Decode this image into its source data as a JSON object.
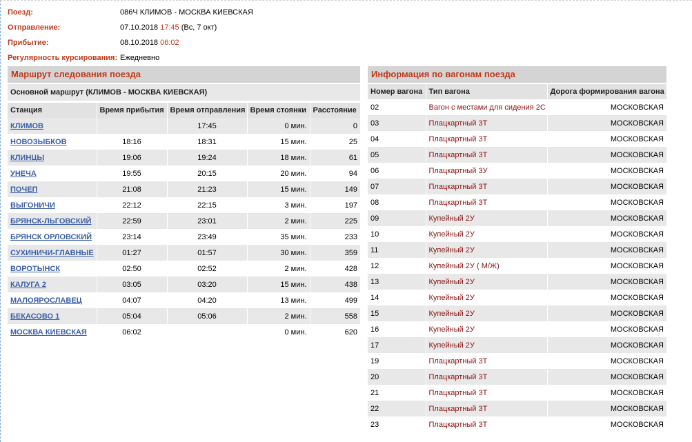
{
  "train_info": {
    "train_label": "Поезд:",
    "train_value": "086Ч КЛИМОВ - МОСКВА КИЕВСКАЯ",
    "departure_label": "Отправление:",
    "departure_date": "07.10.2018",
    "departure_time": "17:45",
    "departure_day": "(Вс, 7 окт)",
    "arrival_label": "Прибытие:",
    "arrival_date": "08.10.2018",
    "arrival_time": "06:02",
    "regularity_label": "Регулярность курсирования:",
    "regularity_value": "Ежедневно"
  },
  "route": {
    "title": "Маршрут следования поезда",
    "subtitle": "Основной маршрут (КЛИМОВ - МОСКВА КИЕВСКАЯ)",
    "headers": [
      "Станция",
      "Время прибытия",
      "Время отправления",
      "Время стоянки",
      "Расстояние"
    ],
    "rows": [
      {
        "station": "КЛИМОВ",
        "arrival": "",
        "departure": "17:45",
        "stop": "0 мин.",
        "distance": "0"
      },
      {
        "station": "НОВОЗЫБКОВ",
        "arrival": "18:16",
        "departure": "18:31",
        "stop": "15 мин.",
        "distance": "25"
      },
      {
        "station": "КЛИНЦЫ",
        "arrival": "19:06",
        "departure": "19:24",
        "stop": "18 мин.",
        "distance": "61"
      },
      {
        "station": "УНЕЧА",
        "arrival": "19:55",
        "departure": "20:15",
        "stop": "20 мин.",
        "distance": "94"
      },
      {
        "station": "ПОЧЕП",
        "arrival": "21:08",
        "departure": "21:23",
        "stop": "15 мин.",
        "distance": "149"
      },
      {
        "station": "ВЫГОНИЧИ",
        "arrival": "22:12",
        "departure": "22:15",
        "stop": "3 мин.",
        "distance": "197"
      },
      {
        "station": "БРЯНСК-ЛЬГОВСКИЙ",
        "arrival": "22:59",
        "departure": "23:01",
        "stop": "2 мин.",
        "distance": "225"
      },
      {
        "station": "БРЯНСК ОРЛОВСКИЙ",
        "arrival": "23:14",
        "departure": "23:49",
        "stop": "35 мин.",
        "distance": "233"
      },
      {
        "station": "СУХИНИЧИ-ГЛАВНЫЕ",
        "arrival": "01:27",
        "departure": "01:57",
        "stop": "30 мин.",
        "distance": "359"
      },
      {
        "station": "ВОРОТЫНСК",
        "arrival": "02:50",
        "departure": "02:52",
        "stop": "2 мин.",
        "distance": "428"
      },
      {
        "station": "КАЛУГА 2",
        "arrival": "03:05",
        "departure": "03:20",
        "stop": "15 мин.",
        "distance": "438"
      },
      {
        "station": "МАЛОЯРОСЛАВЕЦ",
        "arrival": "04:07",
        "departure": "04:20",
        "stop": "13 мин.",
        "distance": "499"
      },
      {
        "station": "БЕКАСОВО 1",
        "arrival": "05:04",
        "departure": "05:06",
        "stop": "2 мин.",
        "distance": "558"
      },
      {
        "station": "МОСКВА КИЕВСКАЯ",
        "arrival": "06:02",
        "departure": "",
        "stop": "0 мин.",
        "distance": "620"
      }
    ]
  },
  "cars": {
    "title": "Информация по вагонам поезда",
    "headers": [
      "Номер вагона",
      "Тип вагона",
      "Дорога формирования вагона"
    ],
    "rows": [
      {
        "number": "02",
        "type": "Вагон с местами для сидения 2С",
        "road": "МОСКОВСКАЯ"
      },
      {
        "number": "03",
        "type": "Плацкартный 3Т",
        "road": "МОСКОВСКАЯ"
      },
      {
        "number": "04",
        "type": "Плацкартный 3Т",
        "road": "МОСКОВСКАЯ"
      },
      {
        "number": "05",
        "type": "Плацкартный 3Т",
        "road": "МОСКОВСКАЯ"
      },
      {
        "number": "06",
        "type": "Плацкартный 3У",
        "road": "МОСКОВСКАЯ"
      },
      {
        "number": "07",
        "type": "Плацкартный 3Т",
        "road": "МОСКОВСКАЯ"
      },
      {
        "number": "08",
        "type": "Плацкартный 3Т",
        "road": "МОСКОВСКАЯ"
      },
      {
        "number": "09",
        "type": "Купейный 2У",
        "road": "МОСКОВСКАЯ"
      },
      {
        "number": "10",
        "type": "Купейный 2У",
        "road": "МОСКОВСКАЯ"
      },
      {
        "number": "11",
        "type": "Купейный 2У",
        "road": "МОСКОВСКАЯ"
      },
      {
        "number": "12",
        "type": "Купейный 2У ( М/Ж)",
        "road": "МОСКОВСКАЯ"
      },
      {
        "number": "13",
        "type": "Купейный 2У",
        "road": "МОСКОВСКАЯ"
      },
      {
        "number": "14",
        "type": "Купейный 2У",
        "road": "МОСКОВСКАЯ"
      },
      {
        "number": "15",
        "type": "Купейный 2У",
        "road": "МОСКОВСКАЯ"
      },
      {
        "number": "16",
        "type": "Купейный 2У",
        "road": "МОСКОВСКАЯ"
      },
      {
        "number": "17",
        "type": "Купейный 2У",
        "road": "МОСКОВСКАЯ"
      },
      {
        "number": "19",
        "type": "Плацкартный 3Т",
        "road": "МОСКОВСКАЯ"
      },
      {
        "number": "20",
        "type": "Плацкартный 3Т",
        "road": "МОСКОВСКАЯ"
      },
      {
        "number": "21",
        "type": "Плацкартный 3Т",
        "road": "МОСКОВСКАЯ"
      },
      {
        "number": "22",
        "type": "Плацкартный 3Т",
        "road": "МОСКОВСКАЯ"
      },
      {
        "number": "23",
        "type": "Плацкартный 3Т",
        "road": "МОСКОВСКАЯ"
      }
    ]
  }
}
